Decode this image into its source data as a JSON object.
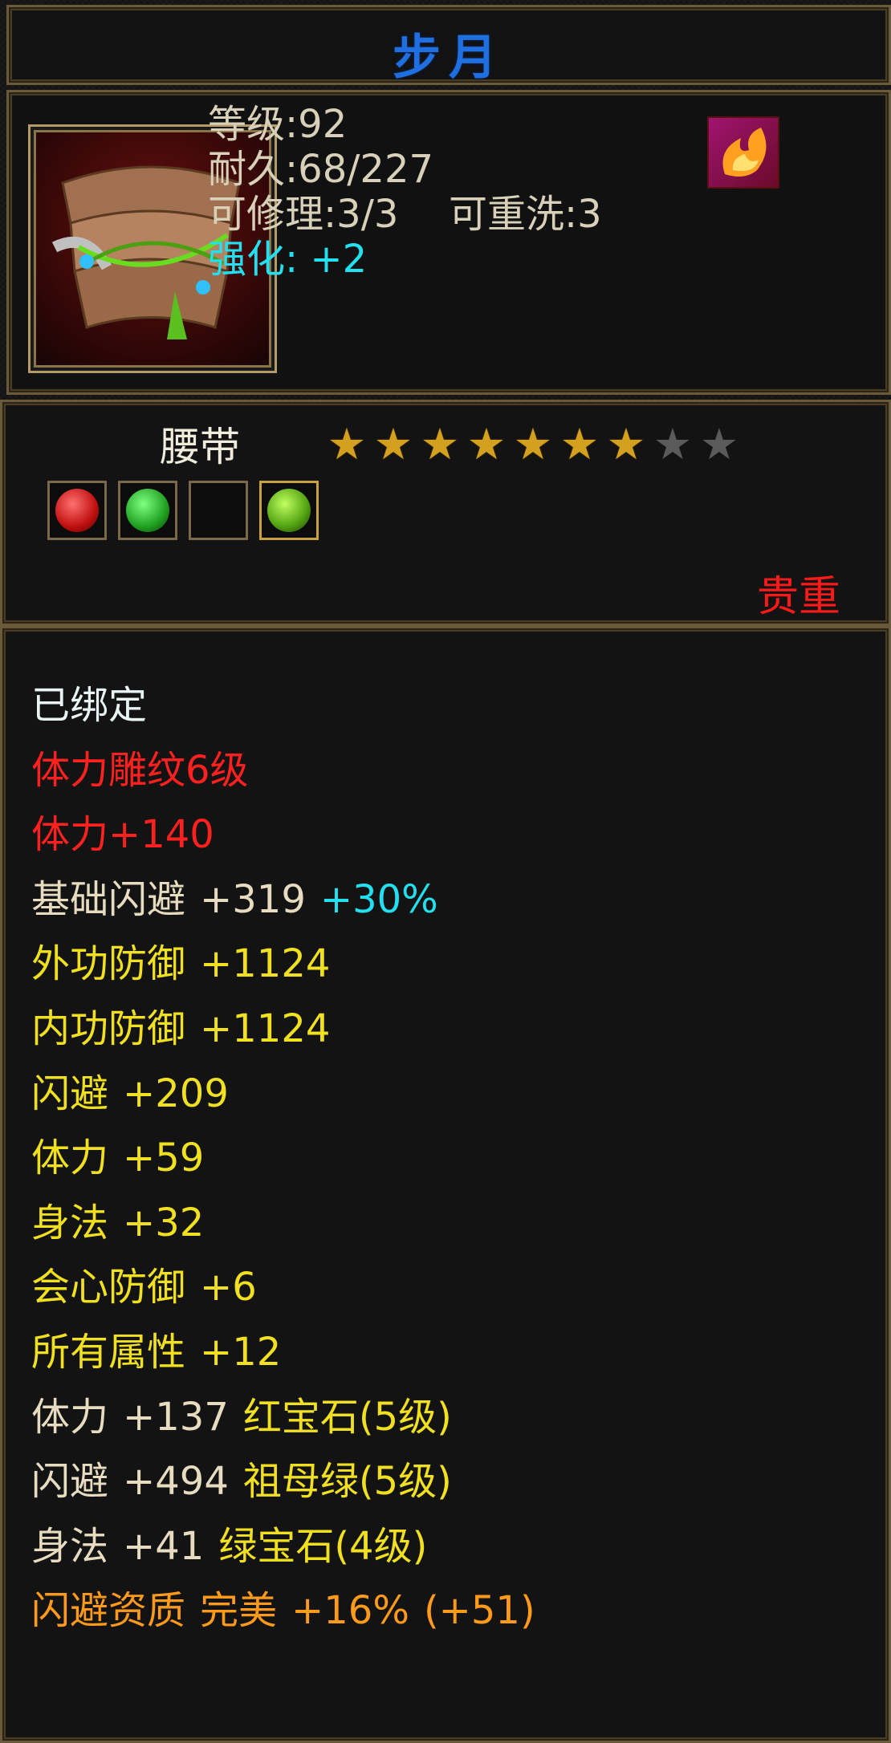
{
  "title": "步月",
  "item": {
    "level": "等级:92",
    "durability": "耐久:68/227",
    "repairable": "可修理:3/3",
    "rewash": "可重洗:3",
    "enhance": "强化: +2"
  },
  "type": {
    "label": "腰带",
    "stars_total": 9,
    "stars_filled": 7
  },
  "quality": "贵重",
  "attributes": [
    {
      "parts": [
        {
          "text": "已绑定",
          "color": "white"
        }
      ]
    },
    {
      "parts": [
        {
          "text": "体力雕纹6级",
          "color": "red"
        }
      ]
    },
    {
      "parts": [
        {
          "text": "体力+140",
          "color": "red"
        }
      ]
    },
    {
      "parts": [
        {
          "text": "基础闪避",
          "color": "cream"
        },
        {
          "text": "+319",
          "color": "cream"
        },
        {
          "text": "+30%",
          "color": "cyan"
        }
      ]
    },
    {
      "parts": [
        {
          "text": "外功防御",
          "color": "yellow"
        },
        {
          "text": "+1124",
          "color": "yellow"
        }
      ]
    },
    {
      "parts": [
        {
          "text": "内功防御",
          "color": "yellow"
        },
        {
          "text": "+1124",
          "color": "yellow"
        }
      ]
    },
    {
      "parts": [
        {
          "text": "闪避",
          "color": "yellow"
        },
        {
          "text": "+209",
          "color": "yellow"
        }
      ]
    },
    {
      "parts": [
        {
          "text": "体力",
          "color": "yellow"
        },
        {
          "text": "+59",
          "color": "yellow"
        }
      ]
    },
    {
      "parts": [
        {
          "text": "身法",
          "color": "yellow"
        },
        {
          "text": "+32",
          "color": "yellow"
        }
      ]
    },
    {
      "parts": [
        {
          "text": "会心防御",
          "color": "yellow"
        },
        {
          "text": "+6",
          "color": "yellow"
        }
      ]
    },
    {
      "parts": [
        {
          "text": "所有属性",
          "color": "yellow"
        },
        {
          "text": "+12",
          "color": "yellow"
        }
      ]
    },
    {
      "parts": [
        {
          "text": "体力",
          "color": "cream"
        },
        {
          "text": "+137",
          "color": "cream"
        },
        {
          "text": "红宝石(5级)",
          "color": "yellow"
        }
      ]
    },
    {
      "parts": [
        {
          "text": "闪避",
          "color": "cream"
        },
        {
          "text": "+494",
          "color": "cream"
        },
        {
          "text": "祖母绿(5级)",
          "color": "yellow"
        }
      ]
    },
    {
      "parts": [
        {
          "text": "身法",
          "color": "cream"
        },
        {
          "text": "+41",
          "color": "cream"
        },
        {
          "text": "绿宝石(4级)",
          "color": "yellow"
        }
      ]
    },
    {
      "parts": [
        {
          "text": "闪避资质",
          "color": "orange"
        },
        {
          "text": "完美",
          "color": "orange"
        },
        {
          "text": "+16%",
          "color": "orange"
        },
        {
          "text": "(+51)",
          "color": "orange"
        }
      ]
    }
  ],
  "icons": {
    "item": "belt-icon",
    "element": "fire-icon",
    "sockets": [
      "ruby-gem-icon",
      "emerald-gem-icon",
      "empty-socket",
      "green-gem-icon"
    ]
  },
  "colors": {
    "title": "#1f6fe0",
    "precious": "#ff1a1a",
    "star_filled": "#d4a020",
    "star_empty": "#5a5a5a"
  }
}
